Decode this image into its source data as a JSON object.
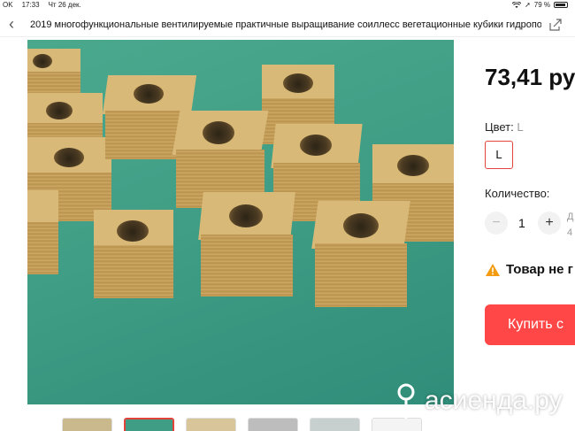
{
  "status_bar": {
    "carrier": "OK",
    "time": "17:33",
    "date": "Чт 26 дек.",
    "battery": "79 %"
  },
  "header": {
    "back_icon": "chevron-left-icon",
    "title": "2019 многофункциональные вентилируемые практичные выращивание соиллесс вегетационные кубики гидропо...",
    "share_icon": "share-icon"
  },
  "product": {
    "price": "73,41 ру",
    "color_label": "Цвет:",
    "color_value": "L",
    "color_option": "L",
    "quantity_label": "Количество:",
    "quantity_minus": "−",
    "quantity_value": "1",
    "quantity_plus": "+",
    "quantity_side_line1": "Д",
    "quantity_side_line2": "4",
    "warning_text": "Товар не г",
    "buy_button": "Купить с"
  },
  "thumbnails": [
    {
      "color": "#c9b98c",
      "active": false
    },
    {
      "color": "#3f9d85",
      "active": true
    },
    {
      "color": "#d8c69a",
      "active": false
    },
    {
      "color": "#bdbdbd",
      "active": false
    },
    {
      "color": "#c8cfcf",
      "active": false
    },
    {
      "color": "#f4f4f4",
      "active": false
    }
  ],
  "watermark": {
    "text": "асиенда.ру"
  },
  "colors": {
    "accent": "#ff4747",
    "selected_border": "#e0443b",
    "warning": "#f39c12"
  }
}
